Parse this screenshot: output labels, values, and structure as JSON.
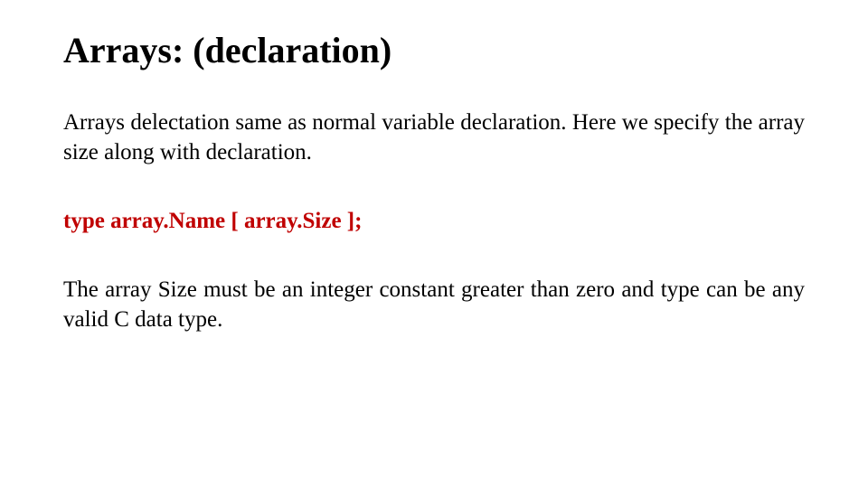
{
  "title": "Arrays: (declaration)",
  "para1": "Arrays delectation same as normal variable declaration.  Here we specify the array size along with declaration.",
  "syntax": "type array.Name [ array.Size ];",
  "para2": "The array Size must be an integer constant greater than zero and type can be any valid C data type."
}
